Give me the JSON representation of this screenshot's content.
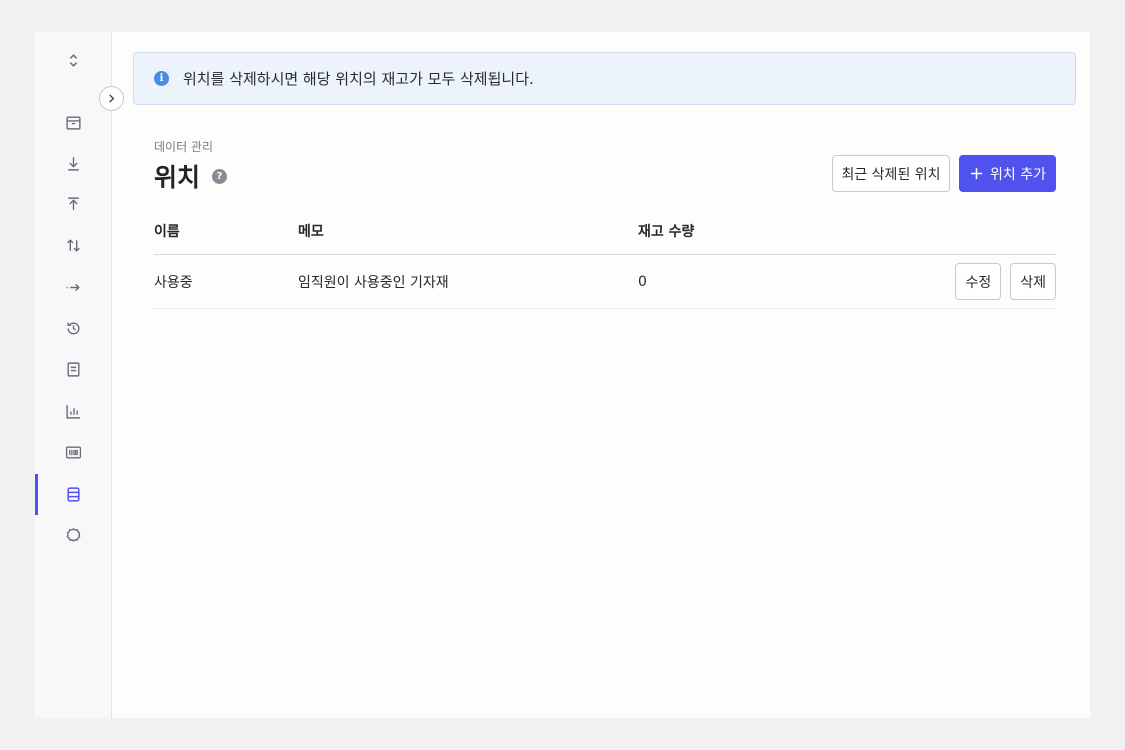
{
  "sidebar": {
    "items": [
      {
        "icon": "chevron-up-down-icon"
      },
      {
        "icon": "box-icon"
      },
      {
        "icon": "download-icon"
      },
      {
        "icon": "upload-icon"
      },
      {
        "icon": "transfer-icon"
      },
      {
        "icon": "dotted-arrow-right-icon"
      },
      {
        "icon": "history-icon"
      },
      {
        "icon": "document-icon"
      },
      {
        "icon": "bar-chart-icon"
      },
      {
        "icon": "barcode-icon"
      },
      {
        "icon": "database-icon",
        "active": true
      },
      {
        "icon": "settings-icon"
      }
    ],
    "active_color": "#4f52ec"
  },
  "banner": {
    "text": "위치를 삭제하시면 해당 위치의 재고가 모두 삭제됩니다.",
    "icon": "info-icon"
  },
  "header": {
    "breadcrumb": "데이터 관리",
    "title": "위치",
    "recent_deleted_label": "최근 삭제된 위치",
    "add_label": "위치 추가"
  },
  "table": {
    "columns": [
      "이름",
      "메모",
      "재고 수량"
    ],
    "rows": [
      {
        "name": "사용중",
        "memo": "임직원이 사용중인 기자재",
        "qty": "0",
        "edit_label": "수정",
        "delete_label": "삭제"
      }
    ]
  },
  "colors": {
    "primary": "#4f52ec",
    "banner_bg": "#edf3fb"
  }
}
